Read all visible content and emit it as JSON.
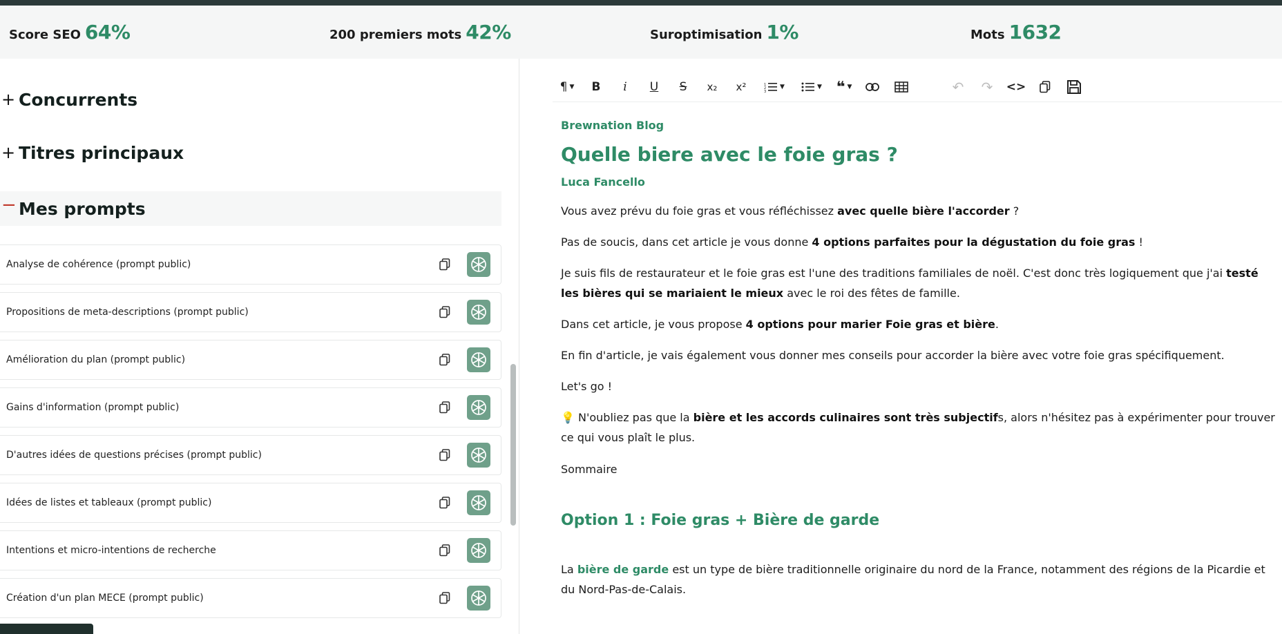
{
  "metrics": [
    {
      "label": "Score SEO",
      "value": "64%"
    },
    {
      "label": "200 premiers mots",
      "value": "42%"
    },
    {
      "label": "Suroptimisation",
      "value": "1%"
    },
    {
      "label": "Mots",
      "value": "1632"
    }
  ],
  "accordions": {
    "competitors": {
      "sign": "+",
      "title": "Concurrents"
    },
    "headings": {
      "sign": "+",
      "title": "Titres principaux"
    },
    "prompts": {
      "sign": "−",
      "title": "Mes prompts"
    }
  },
  "prompts": [
    "Analyse de cohérence (prompt public)",
    "Propositions de meta-descriptions (prompt public)",
    "Amélioration du plan (prompt public)",
    "Gains d'information (prompt public)",
    "D'autres idées de questions précises (prompt public)",
    "Idées de listes et tableaux (prompt public)",
    "Intentions et micro-intentions de recherche",
    "Création d'un plan MECE (prompt public)"
  ],
  "toolbar": {
    "paragraph": "¶",
    "bold": "B",
    "italic": "i",
    "underline": "U",
    "strike": "S",
    "subscript": "x₂",
    "superscript": "x²"
  },
  "article": {
    "blog": "Brewnation Blog",
    "title": "Quelle biere avec le foie gras ?",
    "author": "Luca Fancello",
    "p1_a": "Vous avez prévu du foie gras et vous réfléchissez ",
    "p1_b": "avec quelle bière l'accorder",
    "p1_c": " ?",
    "p2_a": "Pas de soucis, dans cet article je vous donne ",
    "p2_b": "4 options parfaites pour la dégustation du foie gras",
    "p2_c": " !",
    "p3_a": "Je suis fils de restaurateur et le foie gras est l'une des traditions familiales de noël. C'est donc très logiquement que j'ai ",
    "p3_b": "testé les bières qui se mariaient le mieux",
    "p3_c": " avec le roi des fêtes de famille.",
    "p4_a": "Dans cet article, je vous propose ",
    "p4_b": "4 options pour marier Foie gras et bière",
    "p4_c": ".",
    "p5": "En fin d'article, je vais également vous donner mes conseils pour accorder la bière avec votre foie gras spécifiquement.",
    "p6": "Let's go !",
    "p7_icon": "💡",
    "p7_a": " N'oubliez pas que la ",
    "p7_b": "bière et les accords culinaires sont très subjectif",
    "p7_c": "s, alors n'hésitez pas à expérimenter pour trouver ce qui vous plaît le plus.",
    "p8": "Sommaire",
    "h2": "Option 1 : Foie gras + Bière de garde",
    "p9_a": "La ",
    "p9_link": "bière de garde",
    "p9_c": " est un type de bière traditionnelle originaire du nord de la France, notamment des régions de la Picardie et du Nord-Pas-de-Calais."
  },
  "colors": {
    "accent": "#2e8b66",
    "gpt_bg": "#6fa08a",
    "topbar": "#2c3a3a"
  }
}
